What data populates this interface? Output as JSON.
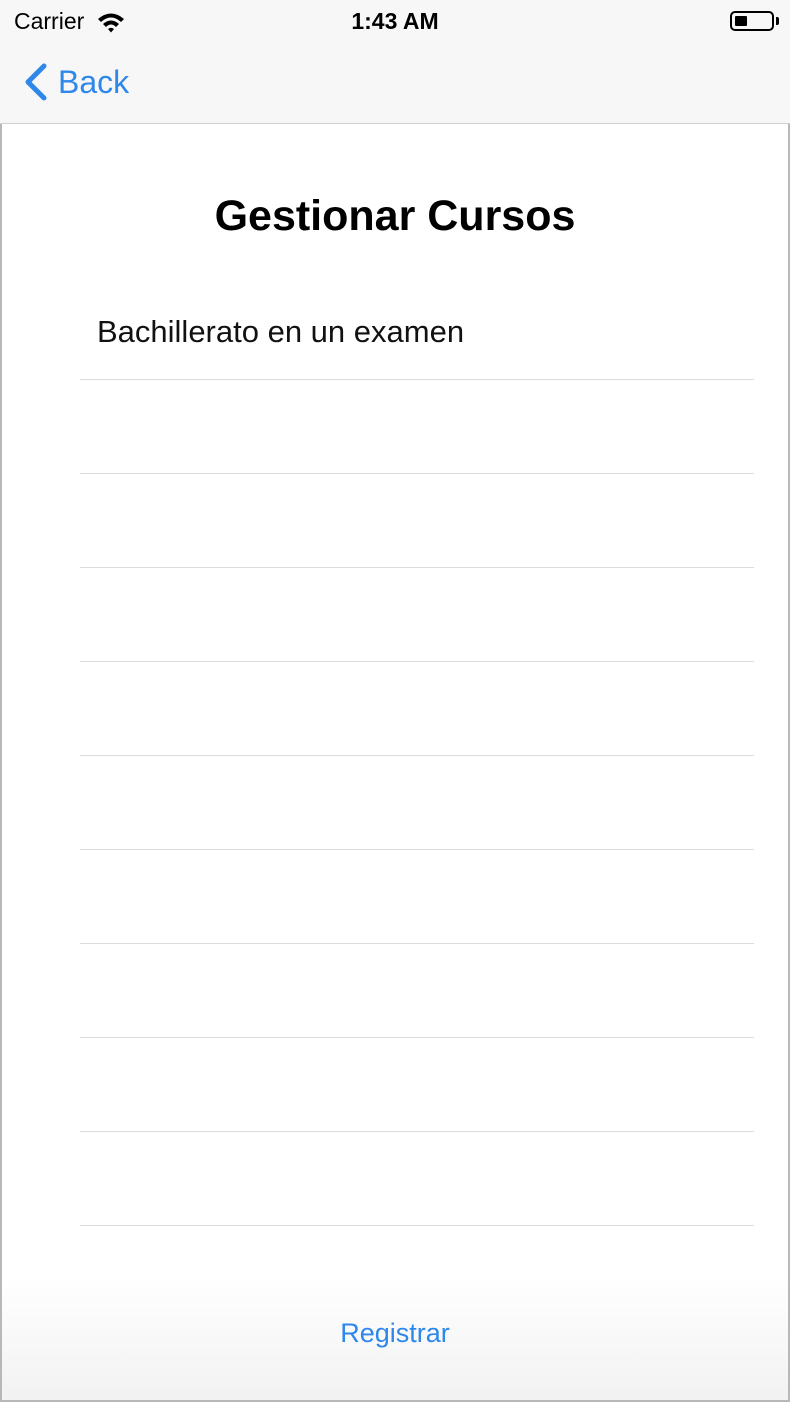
{
  "status_bar": {
    "carrier": "Carrier",
    "time": "1:43 AM"
  },
  "nav": {
    "back_label": "Back"
  },
  "page": {
    "title": "Gestionar Cursos"
  },
  "courses": [
    {
      "label": "Bachillerato en un examen"
    },
    {
      "label": ""
    },
    {
      "label": ""
    },
    {
      "label": ""
    },
    {
      "label": ""
    },
    {
      "label": ""
    },
    {
      "label": ""
    },
    {
      "label": ""
    },
    {
      "label": ""
    },
    {
      "label": ""
    },
    {
      "label": ""
    },
    {
      "label": ""
    }
  ],
  "footer": {
    "register_label": "Registrar"
  },
  "colors": {
    "accent": "#2e87ea",
    "bar_background": "#f7f7f7"
  },
  "icons": [
    "wifi-icon",
    "battery-icon",
    "chevron-left-icon"
  ]
}
